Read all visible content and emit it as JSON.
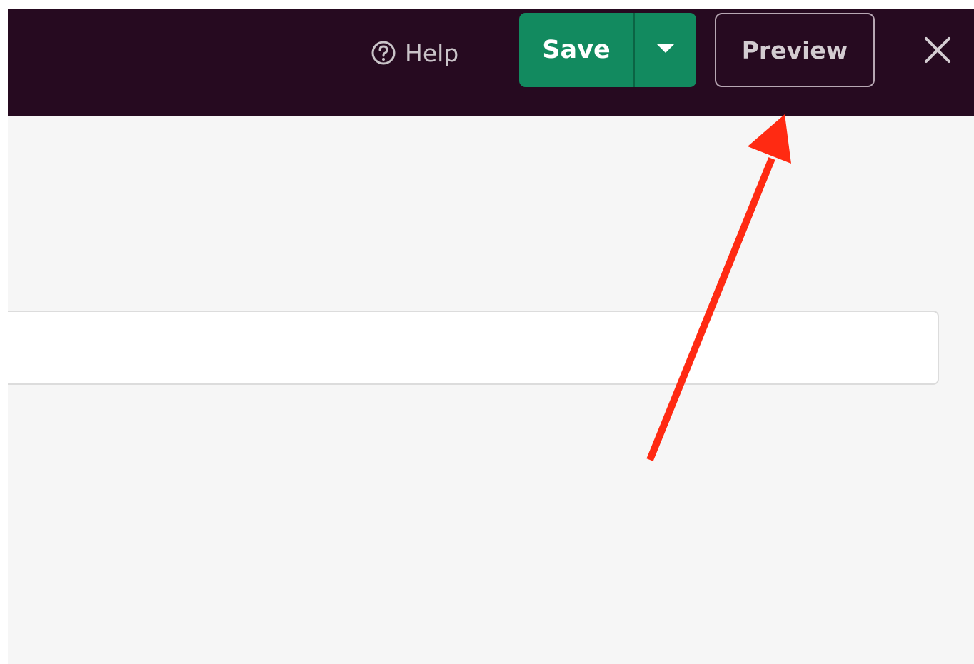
{
  "toolbar": {
    "help_label": "Help",
    "save_label": "Save",
    "preview_label": "Preview"
  },
  "colors": {
    "header_bg": "#260a20",
    "save_green": "#128a5f",
    "annotation_red": "#ff2a12",
    "content_bg": "#f6f6f6"
  },
  "icons": {
    "help": "question-circle-icon",
    "dropdown": "caret-down-icon",
    "close": "close-icon"
  }
}
